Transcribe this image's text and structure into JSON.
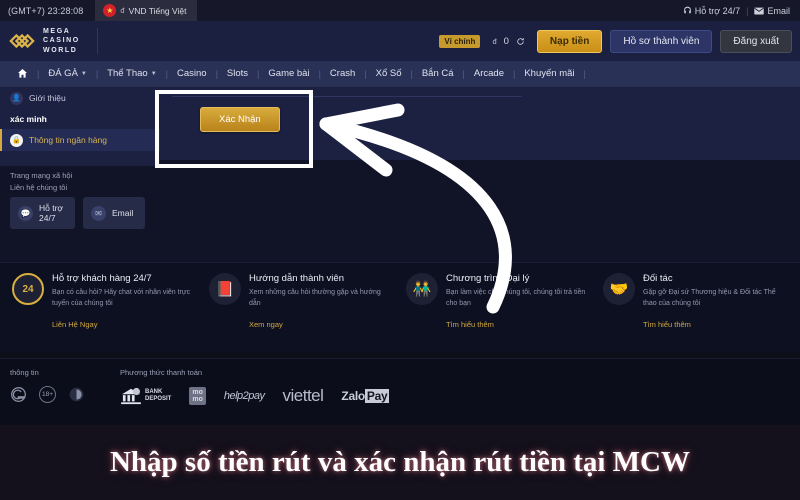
{
  "topbar": {
    "time": "(GMT+7) 23:28:08",
    "flag_icon": "vietnam-flag-icon",
    "currency": "đ",
    "language": "VND Tiếng Việt",
    "support_icon": "headset-icon",
    "support": "Hỗ trợ 24/7",
    "separator": "|",
    "email_icon": "envelope-icon",
    "email": "Email"
  },
  "header": {
    "logo_icon": "mcw-diamond-logo",
    "brand_line1": "MEGA",
    "brand_line2": "CASINO",
    "brand_line3": "WORLD",
    "wallet_label": "Ví chính",
    "currency_symbol": "đ",
    "balance": "0",
    "refresh_icon": "refresh-icon",
    "deposit_label": "Nạp tiền",
    "profile_label": "Hồ sơ thành viên",
    "logout_label": "Đăng xuất"
  },
  "nav": {
    "home_icon": "home-icon",
    "separator": "|",
    "items": [
      {
        "label": "ĐÁ GÀ",
        "caret": true
      },
      {
        "label": "Thể Thao",
        "caret": true
      },
      {
        "label": "Casino",
        "caret": false
      },
      {
        "label": "Slots",
        "caret": false
      },
      {
        "label": "Game bài",
        "caret": false
      },
      {
        "label": "Crash",
        "caret": false
      },
      {
        "label": "Xổ Số",
        "caret": false
      },
      {
        "label": "Bắn Cá",
        "caret": false
      },
      {
        "label": "Arcade",
        "caret": false
      },
      {
        "label": "Khuyến mãi",
        "caret": false
      }
    ]
  },
  "sidebar": {
    "intro_item": "Giới thiệu",
    "intro_icon": "user-intro-icon",
    "section_title": "xác minh",
    "active_item": "Thông tin ngân hàng",
    "active_icon": "bank-lock-icon"
  },
  "content": {
    "confirm_label": "Xác Nhận"
  },
  "social": {
    "title": "Trang mạng xã hội",
    "contact_title": "Liên hệ chúng tôi",
    "cards": [
      {
        "icon": "chat-support-icon",
        "line1": "Hỗ trợ",
        "line2": "24/7"
      },
      {
        "icon": "envelope-icon",
        "line1": "Email",
        "line2": ""
      }
    ]
  },
  "features": [
    {
      "icon": "24-7-cycle-icon",
      "title": "Hỗ trợ khách hàng 24/7",
      "desc": "Bạn có câu hỏi? Hãy chat với nhân viên trực tuyến của chúng tôi",
      "link": "Liên Hệ Ngay"
    },
    {
      "icon": "book-guide-icon",
      "title": "Hướng dẫn thành viên",
      "desc": "Xem những câu hỏi thường gặp và hướng dẫn",
      "link": "Xem ngay"
    },
    {
      "icon": "two-people-icon",
      "title": "Chương trình Đại lý",
      "desc": "Bạn làm việc cho chúng tôi, chúng tôi trả tiền cho bạn",
      "link": "Tìm hiểu thêm"
    },
    {
      "icon": "handshake-icon",
      "title": "Đối tác",
      "desc": "Gặp gỡ Đại sứ Thương hiệu & Đối tác Thể thao của chúng tôi",
      "link": "Tìm hiểu thêm"
    }
  ],
  "payment_footer": {
    "info_label": "thông tin",
    "info_icons": [
      "gamcare-icon",
      "18-plus-icon",
      "responsible-gaming-icon"
    ],
    "age_badge": "18+",
    "payment_label": "Phương thức thanh toán",
    "bank_line1": "BANK",
    "bank_line2": "DEPOSIT",
    "bank_icon": "bank-deposit-icon",
    "momo_line1": "mo",
    "momo_line2": "mo",
    "help2pay": "help2pay",
    "viettel": "viettel",
    "zalo_a": "Zalo",
    "zalo_b": "Pay"
  },
  "annotation": {
    "arrow_icon": "curved-arrow-icon",
    "highlight_icon": "highlight-rectangle",
    "caption": "Nhập số tiền rút và xác nhận rút tiền tại MCW"
  }
}
